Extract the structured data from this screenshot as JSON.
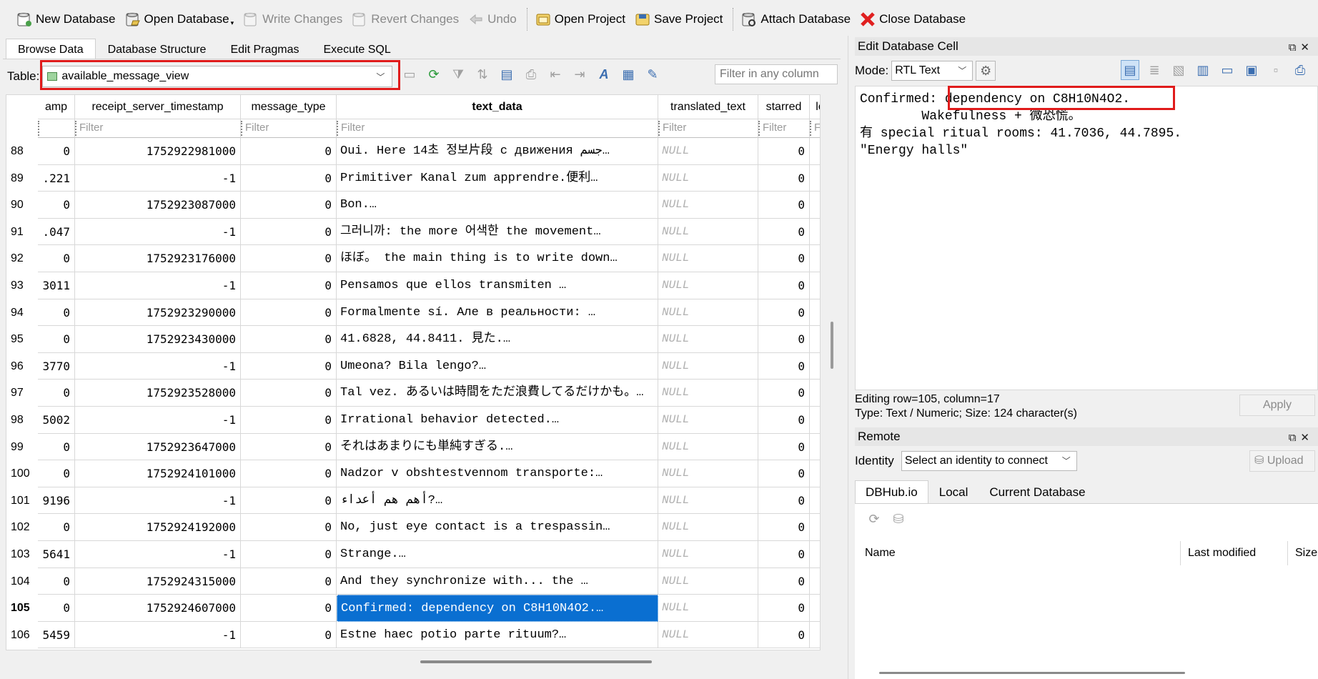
{
  "toolbar": {
    "new_database": "New Database",
    "open_database": "Open Database",
    "write_changes": "Write Changes",
    "revert_changes": "Revert Changes",
    "undo": "Undo",
    "open_project": "Open Project",
    "save_project": "Save Project",
    "attach_database": "Attach Database",
    "close_database": "Close Database"
  },
  "main_tabs": [
    "Browse Data",
    "Database Structure",
    "Edit Pragmas",
    "Execute SQL"
  ],
  "browse": {
    "table_label": "Table:",
    "table_value": "available_message_view",
    "filter_any_placeholder": "Filter in any column",
    "columns": [
      "amp",
      "receipt_server_timestamp",
      "message_type",
      "text_data",
      "translated_text",
      "starred",
      "lo"
    ],
    "filter_placeholder": "Filter",
    "null_text": "NULL",
    "rows": [
      {
        "n": "88",
        "c0": "0",
        "c1": "1752922981000",
        "c2": "0",
        "text": "Oui. Here 14초 정보片段 с движения جسم…",
        "c5": "0"
      },
      {
        "n": "89",
        "c0": ".221",
        "c1": "-1",
        "c2": "0",
        "text": "Primitiver Kanal zum apprendre.便利…",
        "c5": "0"
      },
      {
        "n": "90",
        "c0": "0",
        "c1": "1752923087000",
        "c2": "0",
        "text": "Bon.…",
        "c5": "0"
      },
      {
        "n": "91",
        "c0": ".047",
        "c1": "-1",
        "c2": "0",
        "text": "그러니까: the more 어색한 the movement…",
        "c5": "0"
      },
      {
        "n": "92",
        "c0": "0",
        "c1": "1752923176000",
        "c2": "0",
        "text": "ほぼ。 the main thing is to write down…",
        "c5": "0"
      },
      {
        "n": "93",
        "c0": "3011",
        "c1": "-1",
        "c2": "0",
        "text": "Pensamos que ellos transmiten …",
        "c5": "0"
      },
      {
        "n": "94",
        "c0": "0",
        "c1": "1752923290000",
        "c2": "0",
        "text": "Formalmente sí. Але в реальности: …",
        "c5": "0"
      },
      {
        "n": "95",
        "c0": "0",
        "c1": "1752923430000",
        "c2": "0",
        "text": "41.6828, 44.8411. 見た.…",
        "c5": "0"
      },
      {
        "n": "96",
        "c0": "3770",
        "c1": "-1",
        "c2": "0",
        "text": "Umeona? Bila lengo?…",
        "c5": "0"
      },
      {
        "n": "97",
        "c0": "0",
        "c1": "1752923528000",
        "c2": "0",
        "text": "Tal vez. あるいは時間をただ浪費してるだけかも。…",
        "c5": "0"
      },
      {
        "n": "98",
        "c0": "5002",
        "c1": "-1",
        "c2": "0",
        "text": "Irrational behavior detected.…",
        "c5": "0"
      },
      {
        "n": "99",
        "c0": "0",
        "c1": "1752923647000",
        "c2": "0",
        "text": "それはあまりにも単純すぎる.…",
        "c5": "0"
      },
      {
        "n": "100",
        "c0": "0",
        "c1": "1752924101000",
        "c2": "0",
        "text": "Nadzor v obshtestvennom transporte:…",
        "c5": "0"
      },
      {
        "n": "101",
        "c0": "9196",
        "c1": "-1",
        "c2": "0",
        "text": "أهم هم أعداء?…",
        "c5": "0"
      },
      {
        "n": "102",
        "c0": "0",
        "c1": "1752924192000",
        "c2": "0",
        "text": "No, just eye contact is a trespassin…",
        "c5": "0"
      },
      {
        "n": "103",
        "c0": "5641",
        "c1": "-1",
        "c2": "0",
        "text": "Strange.…",
        "c5": "0"
      },
      {
        "n": "104",
        "c0": "0",
        "c1": "1752924315000",
        "c2": "0",
        "text": "And they synchronize with... the …",
        "c5": "0"
      },
      {
        "n": "105",
        "c0": "0",
        "c1": "1752924607000",
        "c2": "0",
        "text": "Confirmed: dependency on C8H10N4O2.…",
        "c5": "0",
        "selected": true
      },
      {
        "n": "106",
        "c0": "5459",
        "c1": "-1",
        "c2": "0",
        "text": "Estne haec potio parte rituum?…",
        "c5": "0"
      }
    ]
  },
  "edit_cell": {
    "title": "Edit Database Cell",
    "mode_label": "Mode:",
    "mode_value": "RTL Text",
    "line1_prefix": "Confirmed: ",
    "line1_highlight": "dependency on C8H10N4O2.",
    "line2": "        Wakefulness + 微恐慌。",
    "line3": "有 special ritual rooms: 41.7036, 44.7895.",
    "line4": "\"Energy halls\"",
    "status_row": "Editing row=105, column=17",
    "status_type": "Type: Text / Numeric; Size: 124 character(s)",
    "apply": "Apply"
  },
  "remote": {
    "title": "Remote",
    "identity_label": "Identity",
    "identity_value": "Select an identity to connect",
    "upload": "Upload",
    "tabs": [
      "DBHub.io",
      "Local",
      "Current Database"
    ],
    "columns": [
      "Name",
      "Last modified",
      "Size"
    ]
  },
  "colors": {
    "accent_selected": "#0a6fd1",
    "highlight_red": "#e01b1b"
  }
}
